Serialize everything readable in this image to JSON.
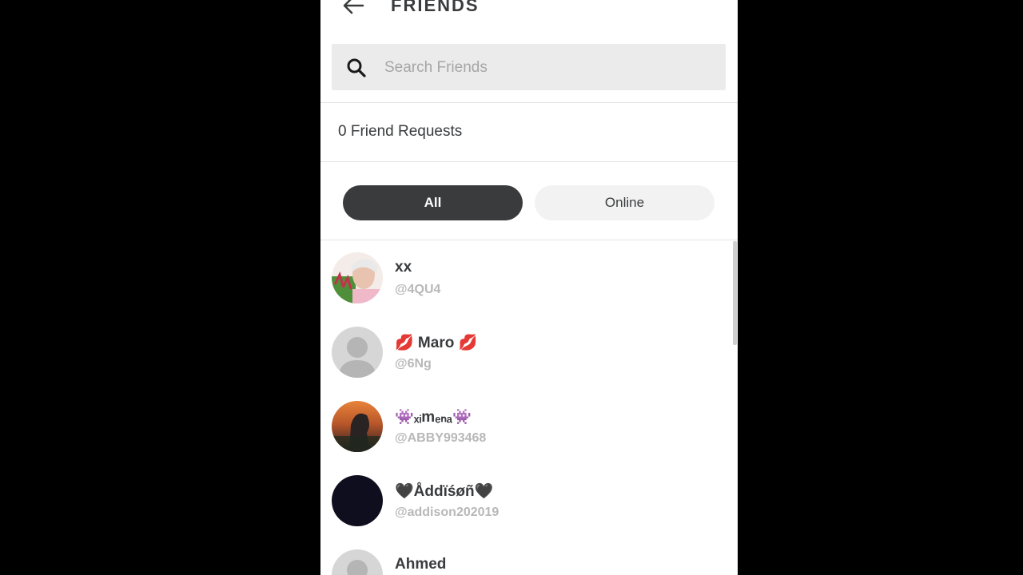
{
  "header": {
    "title": "FRIENDS",
    "back_icon": "arrow-left-icon"
  },
  "search": {
    "placeholder": "Search Friends",
    "value": "",
    "icon": "search-icon"
  },
  "requests": {
    "label": "0 Friend Requests"
  },
  "filters": {
    "all_label": "All",
    "online_label": "Online",
    "selected": "All"
  },
  "friends": [
    {
      "display_name": "xx",
      "username": "@4QU4",
      "avatar": "photo-avatar"
    },
    {
      "display_name": "💋 Maro 💋",
      "username": "@6Ng",
      "avatar": "default-avatar"
    },
    {
      "display_name": "👾ₓᵢmₑₙₐ👾",
      "username": "@ABBY993468",
      "avatar": "sunset-avatar"
    },
    {
      "display_name": "🖤Åddïśøñ🖤",
      "username": "@addison202019",
      "avatar": "dark-avatar"
    },
    {
      "display_name": "Ahmed",
      "username": "",
      "avatar": "default-avatar"
    }
  ],
  "colors": {
    "text": "#393b3d",
    "muted": "#b8b8b8",
    "selected_pill": "#393b3d",
    "search_bg": "#ebebeb"
  }
}
